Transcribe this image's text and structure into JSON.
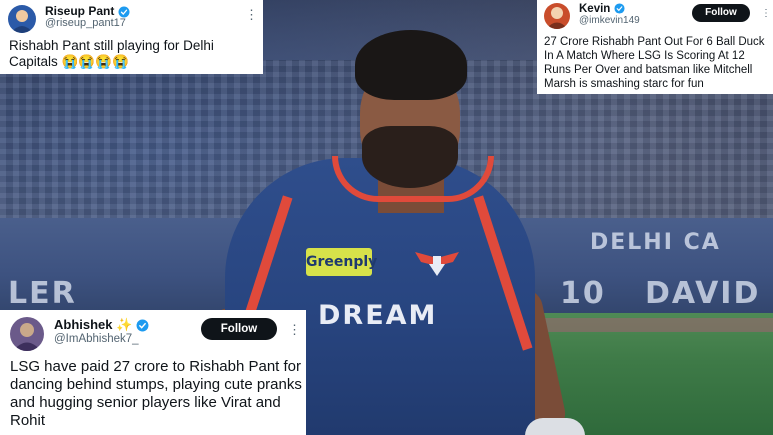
{
  "tweets": [
    {
      "name": "Riseup Pant",
      "handle": "@riseup_pant17",
      "text": "Rishabh Pant still playing for Delhi Capitals 😭😭😭😭",
      "verified": true
    },
    {
      "name": "Kevin",
      "handle": "@imkevin149",
      "follow_label": "Follow",
      "text": "27 Crore Rishabh Pant Out For 6 Ball Duck In A Match Where LSG Is Scoring At 12 Runs Per Over and batsman like Mitchell Marsh is smashing starc for fun",
      "verified": true
    },
    {
      "name": "Abhishek ✨",
      "handle": "@ImAbhishek7_",
      "follow_label": "Follow",
      "text": "LSG have paid 27 crore to Rishabh Pant for dancing behind stumps, playing cute pranks and hugging senior players like Virat and Rohit",
      "verified": true
    }
  ],
  "more_glyph": "⋮",
  "photo": {
    "jersey_sponsor": "Greenply",
    "jersey_text": "DREAM",
    "hoarding_left": "LER",
    "hoarding_mid": "10",
    "hoarding_right": "DAVID",
    "hoarding_top_right": "DELHI CA"
  },
  "colors": {
    "verified": "#1d9bf0",
    "follow_bg": "#0f1419",
    "jersey": "#2f4e8c",
    "jersey_accent": "#e04a3b"
  }
}
